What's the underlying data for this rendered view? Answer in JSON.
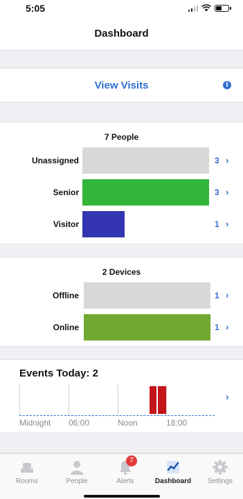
{
  "status": {
    "time": "5:05"
  },
  "header": {
    "title": "Dashboard"
  },
  "visits": {
    "link_label": "View Visits",
    "info_icon": "info-icon",
    "info_glyph": "i"
  },
  "people": {
    "title": "7 People",
    "rows": [
      {
        "label": "Unassigned",
        "count": "3",
        "fill_fraction": 1.0,
        "color": "#d8d8d8"
      },
      {
        "label": "Senior",
        "count": "3",
        "fill_fraction": 1.0,
        "color": "#33b53a"
      },
      {
        "label": "Visitor",
        "count": "1",
        "fill_fraction": 0.333,
        "color": "#3336b0"
      }
    ]
  },
  "devices": {
    "title": "2 Devices",
    "rows": [
      {
        "label": "Offline",
        "count": "1",
        "fill_fraction": 1.0,
        "color": "#d8d8d8"
      },
      {
        "label": "Online",
        "count": "1",
        "fill_fraction": 1.0,
        "color": "#6fa92f"
      }
    ]
  },
  "events": {
    "title": "Events Today: 2",
    "time_labels": [
      "Midnight",
      "06:00",
      "Noon",
      "18:00"
    ],
    "event_color": "#c4141c"
  },
  "tabs": [
    {
      "label": "Rooms",
      "icon": "bed-icon",
      "active": false
    },
    {
      "label": "People",
      "icon": "person-icon",
      "active": false
    },
    {
      "label": "Alerts",
      "icon": "bell-icon",
      "active": false,
      "badge": "7"
    },
    {
      "label": "Dashboard",
      "icon": "chart-icon",
      "active": true
    },
    {
      "label": "Settings",
      "icon": "gear-icon",
      "active": false
    }
  ],
  "colors": {
    "accent": "#2f6fcf",
    "band": "#efeff4",
    "badge": "#e63b3b"
  }
}
